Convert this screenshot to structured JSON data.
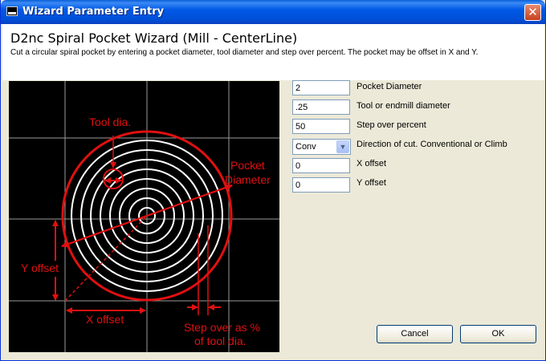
{
  "window": {
    "title": "Wizard Parameter Entry",
    "close_glyph": "✕"
  },
  "header": {
    "heading": "D2nc Spiral Pocket Wizard (Mill - CenterLine)",
    "description": "Cut a circular spiral pocket by entering a pocket diameter, tool diameter and step over percent. The pocket may be offset in X and Y."
  },
  "diagram": {
    "labels": {
      "tool_dia": "Tool dia.",
      "pocket_line1": "Pocket",
      "pocket_line2": "Diameter",
      "y_offset": "Y offset",
      "x_offset": "X offset",
      "stepover_line1": "Step over as %",
      "stepover_line2": "of tool dia."
    },
    "colors": {
      "background": "#000000",
      "grid": "#9a9a9a",
      "annotation": "#e01010",
      "spiral": "#ffffff"
    }
  },
  "form": {
    "fields": [
      {
        "value": "2",
        "label": "Pocket Diameter"
      },
      {
        "value": ".25",
        "label": "Tool or endmill diameter"
      },
      {
        "value": "50",
        "label": "Step over percent"
      },
      {
        "value": "Conv",
        "label": "Direction of cut. Conventional or Climb",
        "type": "select"
      },
      {
        "value": "0",
        "label": "X offset"
      },
      {
        "value": "0",
        "label": "Y offset"
      }
    ]
  },
  "buttons": {
    "cancel": "Cancel",
    "ok": "OK"
  }
}
